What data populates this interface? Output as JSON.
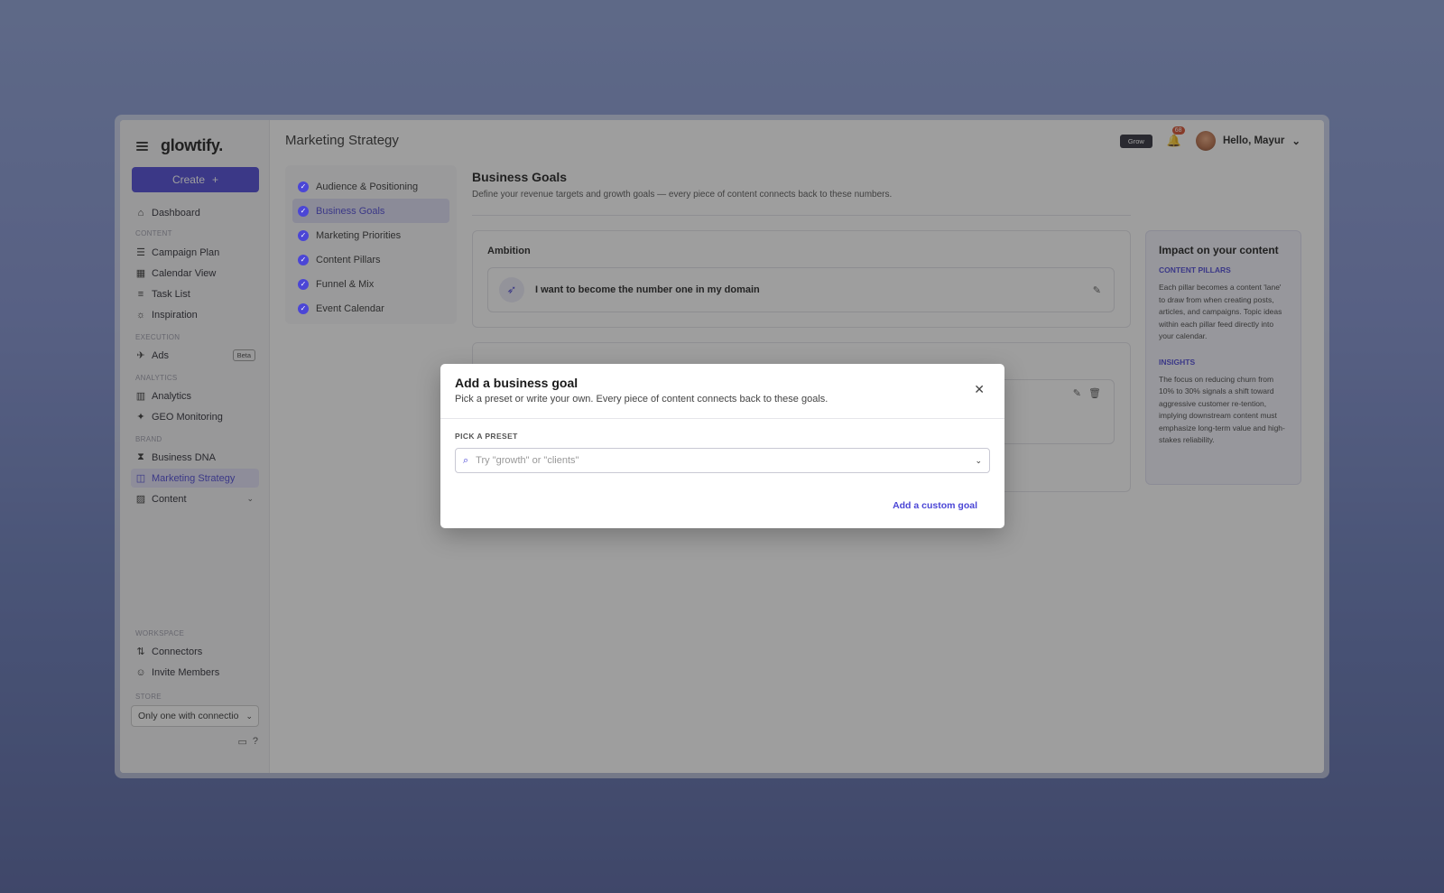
{
  "app": {
    "logo": "glowtify.",
    "create_label": "Create",
    "create_plus": "+"
  },
  "sidebar": {
    "top_items": [
      {
        "label": "Dashboard",
        "icon": "home-icon"
      }
    ],
    "sections": [
      {
        "title": "CONTENT",
        "items": [
          {
            "label": "Campaign Plan",
            "icon": "layers-icon"
          },
          {
            "label": "Calendar View",
            "icon": "calendar-icon"
          },
          {
            "label": "Task List",
            "icon": "list-icon"
          },
          {
            "label": "Inspiration",
            "icon": "lightbulb-icon"
          }
        ]
      },
      {
        "title": "EXECUTION",
        "items": [
          {
            "label": "Ads",
            "icon": "megaphone-icon",
            "badge": "Beta"
          }
        ]
      },
      {
        "title": "ANALYTICS",
        "items": [
          {
            "label": "Analytics",
            "icon": "bar-chart-icon"
          },
          {
            "label": "GEO Monitoring",
            "icon": "sparkle-icon"
          }
        ]
      },
      {
        "title": "BRAND",
        "items": [
          {
            "label": "Business DNA",
            "icon": "dna-icon"
          },
          {
            "label": "Marketing Strategy",
            "icon": "book-icon"
          },
          {
            "label": "Content",
            "icon": "image-icon"
          }
        ]
      },
      {
        "title": "WORKSPACE",
        "items": [
          {
            "label": "Connectors",
            "icon": "connector-icon"
          },
          {
            "label": "Invite Members",
            "icon": "user-plus-icon"
          }
        ]
      },
      {
        "title": "STORE"
      }
    ],
    "store_value": "Only one with connectio"
  },
  "header": {
    "title": "Marketing Strategy",
    "plan_badge": "Grow",
    "notifications": "68",
    "greeting": "Hello, Mayur"
  },
  "steps": [
    "Audience & Positioning",
    "Business Goals",
    "Marketing Priorities",
    "Content Pillars",
    "Funnel & Mix",
    "Event Calendar"
  ],
  "business_goals": {
    "title": "Business Goals",
    "subtitle": "Define your revenue targets and growth goals — every piece of content connects back to these numbers.",
    "ambition_label": "Ambition",
    "ambition_text": "I want to become the number one in my domain"
  },
  "impact": {
    "title": "Impact on your content",
    "pillars_heading": "CONTENT PILLARS",
    "pillars_text": "Each pillar becomes a content 'lane' to draw from when creating posts, articles, and campaigns. Topic ideas within each pillar feed directly into your calendar.",
    "insights_heading": "INSIGHTS",
    "insights_text": "The focus on reducing churn from 10% to 30% signals a shift toward aggressive customer re-tention, implying downstream content must emphasize long-term value and high-stakes reliability."
  },
  "modal": {
    "title": "Add a business goal",
    "subtitle": "Pick a preset or write your own. Every piece of content connects back to these goals.",
    "preset_label": "PICK A PRESET",
    "preset_placeholder": "Try \"growth\" or \"clients\"",
    "custom_goal": "Add a custom goal"
  }
}
